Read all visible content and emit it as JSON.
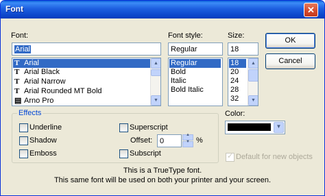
{
  "window": {
    "title": "Font"
  },
  "labels": {
    "font": "Font:",
    "font_style": "Font style:",
    "size": "Size:",
    "effects": "Effects",
    "color": "Color:",
    "offset": "Offset:",
    "percent": "%"
  },
  "font": {
    "value": "Arial",
    "items": [
      "Arial",
      "Arial Black",
      "Arial Narrow",
      "Arial Rounded MT Bold",
      "Arno Pro"
    ],
    "icons": [
      "truetype-icon",
      "truetype-icon",
      "truetype-icon",
      "truetype-icon",
      "opentype-icon"
    ]
  },
  "style": {
    "value": "Regular",
    "items": [
      "Regular",
      "Bold",
      "Italic",
      "Bold Italic"
    ]
  },
  "size": {
    "value": "18",
    "items": [
      "18",
      "20",
      "24",
      "28",
      "32"
    ]
  },
  "buttons": {
    "ok": "OK",
    "cancel": "Cancel"
  },
  "effects": {
    "underline": "Underline",
    "shadow": "Shadow",
    "emboss": "Emboss",
    "superscript": "Superscript",
    "subscript": "Subscript",
    "offset_value": "0"
  },
  "color": {
    "value": "#000000"
  },
  "default_new_objects": "Default for new objects",
  "info": {
    "line1": "This is a TrueType font.",
    "line2": "This same font will be used on both your printer and your screen."
  }
}
